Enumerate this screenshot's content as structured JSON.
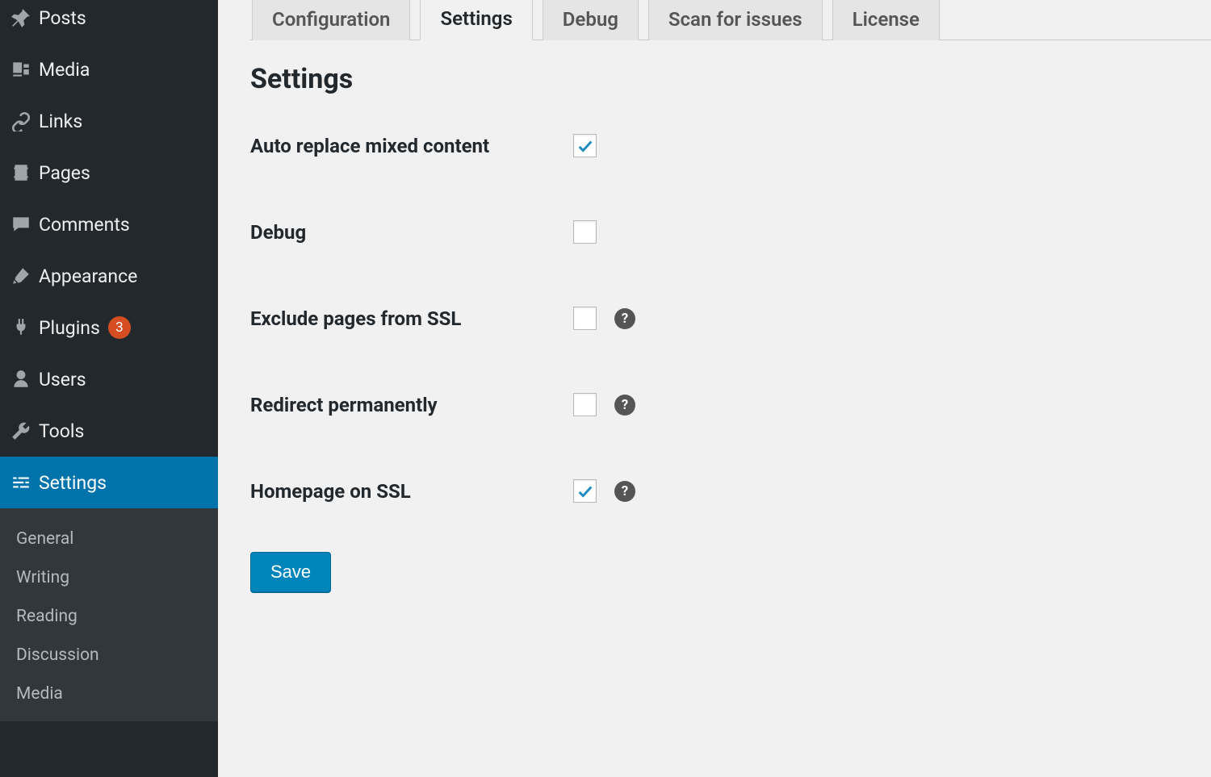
{
  "sidebar": {
    "items": [
      {
        "label": "Posts",
        "icon": "pin"
      },
      {
        "label": "Media",
        "icon": "media"
      },
      {
        "label": "Links",
        "icon": "link"
      },
      {
        "label": "Pages",
        "icon": "page"
      },
      {
        "label": "Comments",
        "icon": "comment"
      },
      {
        "label": "Appearance",
        "icon": "brush"
      },
      {
        "label": "Plugins",
        "icon": "plug",
        "badge": "3"
      },
      {
        "label": "Users",
        "icon": "user"
      },
      {
        "label": "Tools",
        "icon": "wrench"
      },
      {
        "label": "Settings",
        "icon": "sliders",
        "current": true
      }
    ],
    "submenu": [
      {
        "label": "General"
      },
      {
        "label": "Writing"
      },
      {
        "label": "Reading"
      },
      {
        "label": "Discussion"
      },
      {
        "label": "Media"
      }
    ]
  },
  "tabs": [
    {
      "label": "Configuration"
    },
    {
      "label": "Settings",
      "active": true
    },
    {
      "label": "Debug"
    },
    {
      "label": "Scan for issues"
    },
    {
      "label": "License"
    }
  ],
  "page": {
    "title": "Settings"
  },
  "settings": {
    "rows": [
      {
        "label": "Auto replace mixed content",
        "checked": true,
        "help": false
      },
      {
        "label": "Debug",
        "checked": false,
        "help": false
      },
      {
        "label": "Exclude pages from SSL",
        "checked": false,
        "help": true
      },
      {
        "label": "Redirect permanently",
        "checked": false,
        "help": true
      },
      {
        "label": "Homepage on SSL",
        "checked": true,
        "help": true
      }
    ],
    "save_label": "Save",
    "help_symbol": "?"
  }
}
